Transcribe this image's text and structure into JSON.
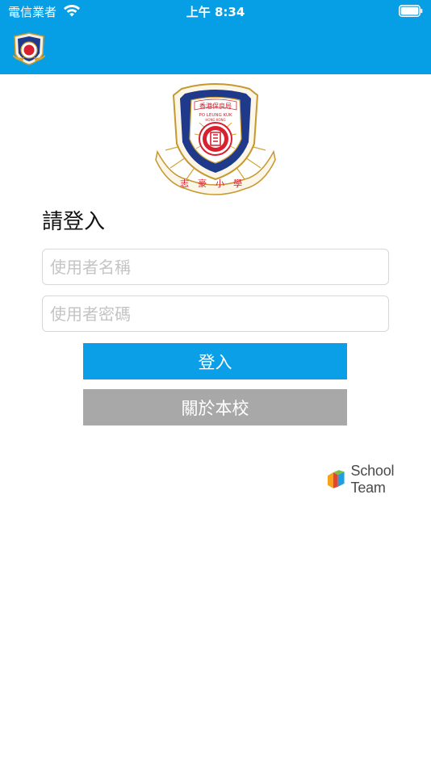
{
  "status_bar": {
    "carrier": "電信業者",
    "time": "上午 8:34"
  },
  "crest": {
    "motto": "志豪小學",
    "org_zh": "香港保良局",
    "org_en_line1": "PO LEUNG KUK",
    "org_en_line2": "HONG KONG"
  },
  "login": {
    "title": "請登入",
    "username_placeholder": "使用者名稱",
    "password_placeholder": "使用者密碼",
    "login_button": "登入",
    "about_button": "關於本校"
  },
  "brand": {
    "name": "School Team"
  },
  "colors": {
    "header": "#069fe6",
    "login_button": "#0a9fe6",
    "about_button": "#a8a8a8",
    "crest_navy": "#1f3a8a",
    "crest_red": "#d8202f",
    "crest_gold": "#d4a437"
  }
}
